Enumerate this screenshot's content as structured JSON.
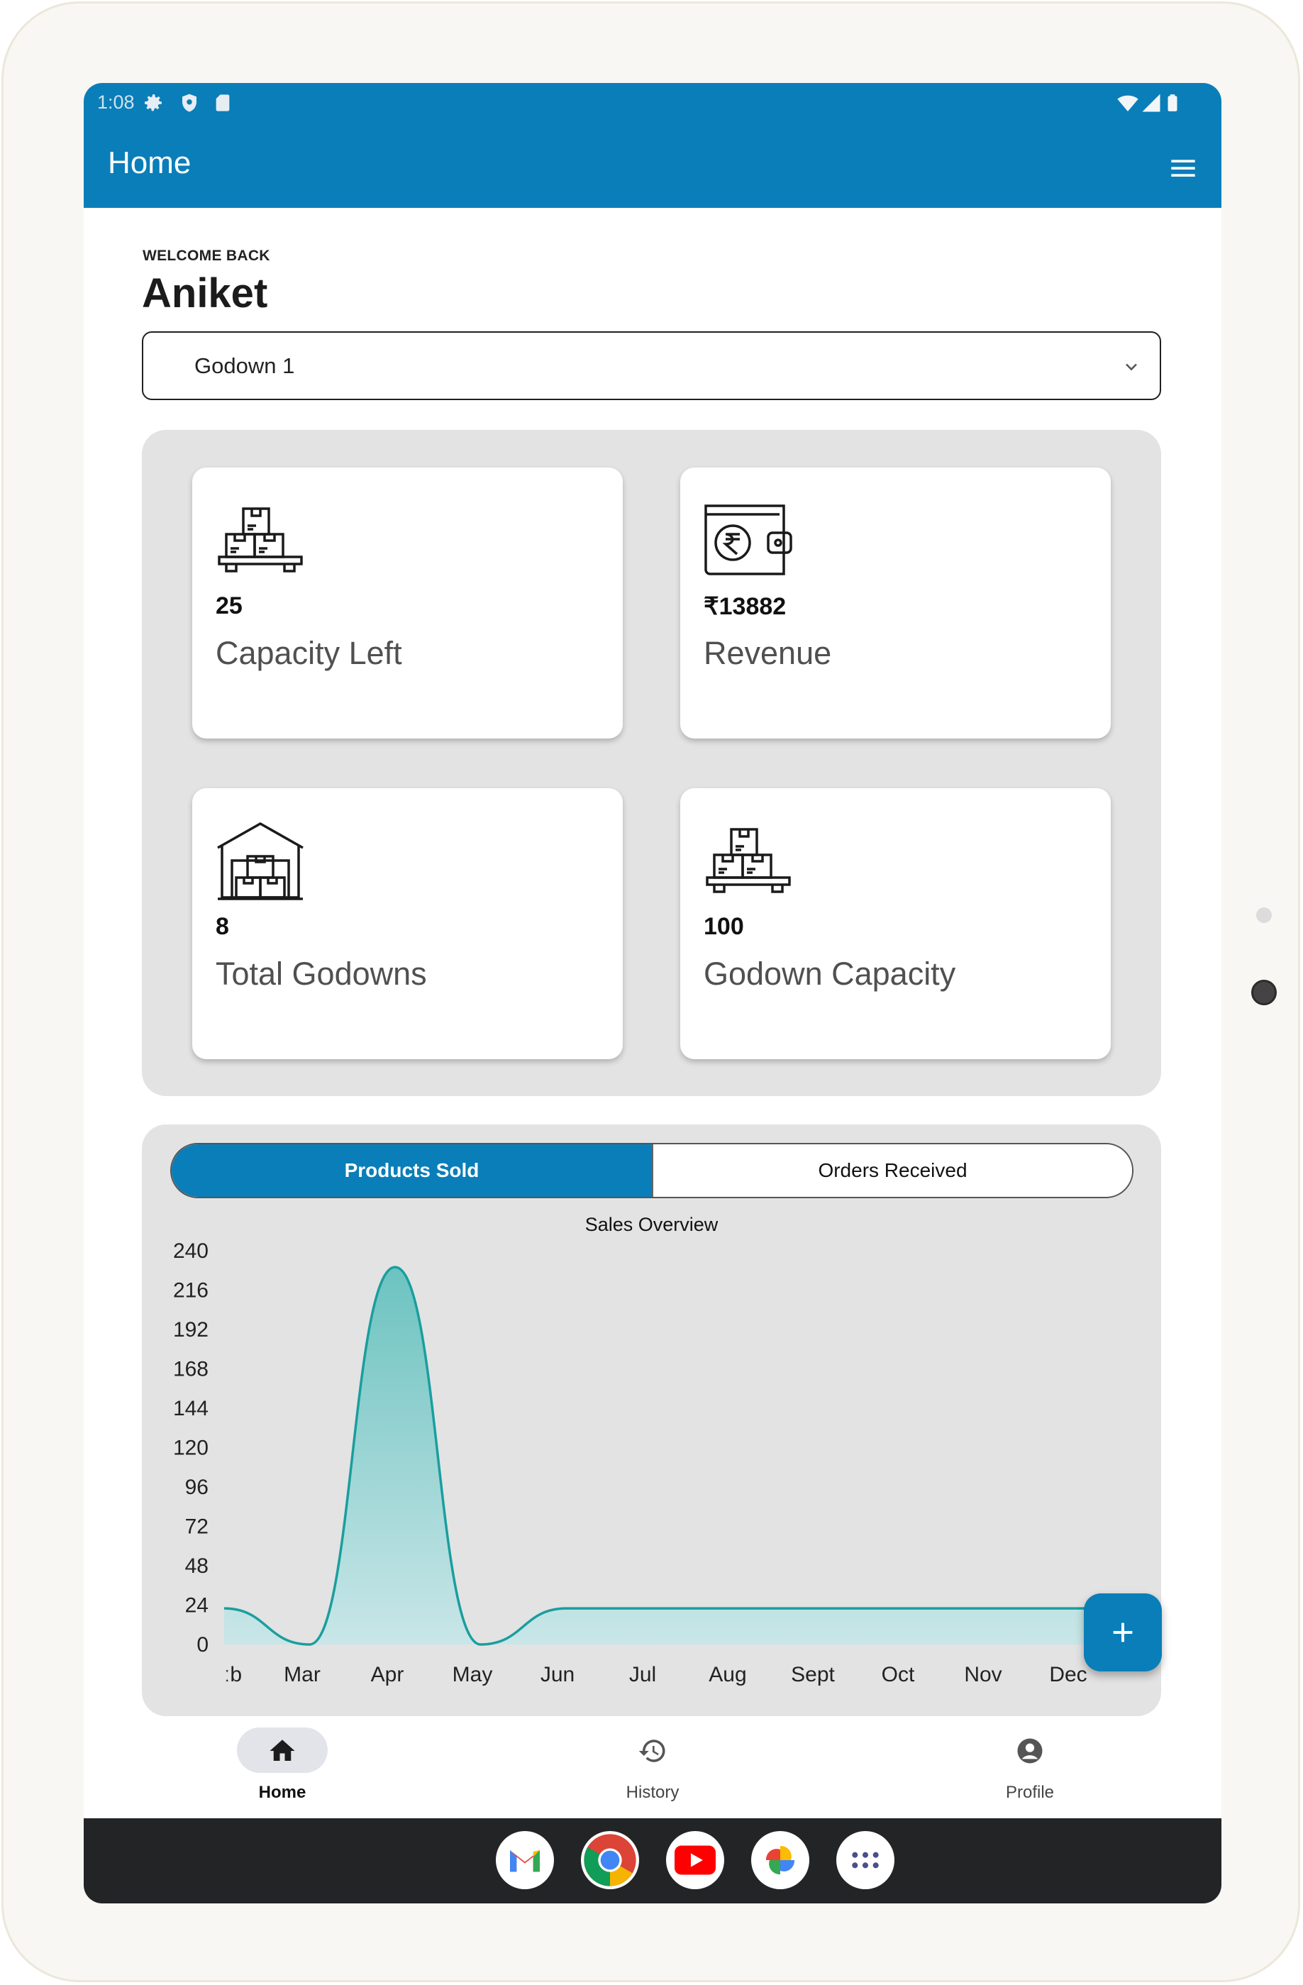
{
  "status_bar": {
    "time": "1:08",
    "left_icons": [
      "settings-icon",
      "shield-icon",
      "sd-card-icon"
    ],
    "right_icons": [
      "wifi-icon",
      "signal-icon",
      "battery-icon"
    ]
  },
  "app_bar": {
    "title": "Home",
    "menu_icon": "hamburger-menu-icon"
  },
  "greeting": {
    "welcome": "WELCOME BACK",
    "name": "Aniket"
  },
  "godown_select": {
    "value": "Godown 1"
  },
  "stats": [
    {
      "icon": "boxes-pallet-icon",
      "value": "25",
      "label": "Capacity Left"
    },
    {
      "icon": "wallet-rupee-icon",
      "value": "₹13882",
      "label": "Revenue"
    },
    {
      "icon": "warehouse-icon",
      "value": "8",
      "label": "Total Godowns"
    },
    {
      "icon": "boxes-pallet-icon",
      "value": "100",
      "label": "Godown Capacity"
    }
  ],
  "chart_tabs": {
    "active": "Products Sold",
    "inactive": "Orders Received"
  },
  "chart_data": {
    "type": "area",
    "title": "Sales Overview",
    "categories": [
      "Feb",
      "Mar",
      "Apr",
      "May",
      "Jun",
      "Jul",
      "Aug",
      "Sept",
      "Oct",
      "Nov",
      "Dec"
    ],
    "visible_x_labels": [
      "ːb",
      "Mar",
      "Apr",
      "May",
      "Jun",
      "Jul",
      "Aug",
      "Sept",
      "Oct",
      "Nov",
      "Dec"
    ],
    "series": [
      {
        "values": [
          22,
          0,
          230,
          0,
          22,
          22,
          22,
          22,
          22,
          22,
          22
        ]
      }
    ],
    "y_ticks": [
      0,
      24,
      48,
      72,
      96,
      120,
      144,
      168,
      192,
      216,
      240
    ],
    "ylim": [
      0,
      240
    ],
    "grid": false,
    "legend": "none",
    "colors": {
      "line": "#1a9e9e",
      "fill_top": "#6cc3c0",
      "fill_bottom": "#c9e6e8"
    }
  },
  "fab": {
    "icon": "plus-icon"
  },
  "bottom_nav": [
    {
      "label": "Home",
      "icon": "home-icon",
      "active": true
    },
    {
      "label": "History",
      "icon": "history-icon",
      "active": false
    },
    {
      "label": "Profile",
      "icon": "profile-icon",
      "active": false
    }
  ],
  "dock": [
    "gmail-icon",
    "chrome-icon",
    "youtube-icon",
    "photos-icon",
    "app-drawer-icon"
  ],
  "colors": {
    "primary": "#0a7eb8",
    "panel": "#e3e3e3"
  }
}
